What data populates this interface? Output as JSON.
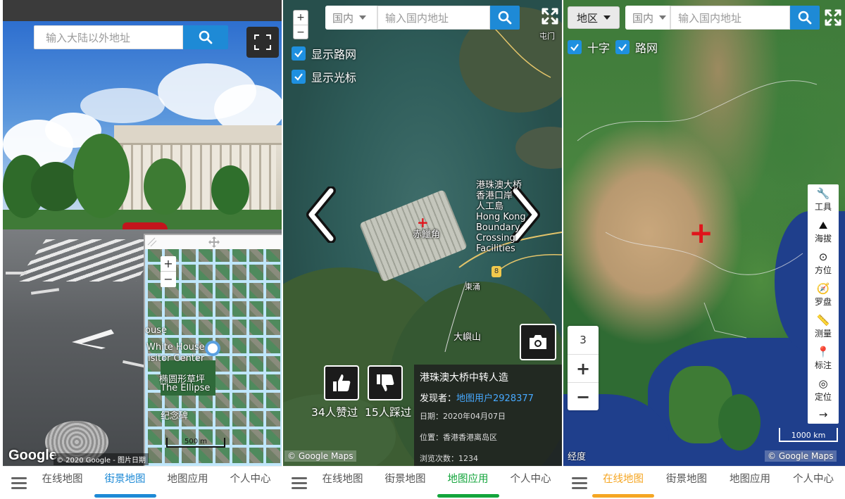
{
  "panel_streetview": {
    "search_placeholder": "输入大陆以外地址",
    "google_logo": "Google",
    "copyright": "© 2020 Google - 图片日期",
    "inset_map": {
      "zoom_in": "+",
      "zoom_out": "−",
      "labels": [
        "ouse",
        "White House",
        "isitor Center",
        "椭圆形草坪",
        "The Ellipse",
        "纪念碑"
      ],
      "scale": "500 m"
    }
  },
  "panel_satellite": {
    "region_select": "国内",
    "search_placeholder": "输入国内地址",
    "zoom_in": "+",
    "zoom_out": "−",
    "show_roads_label": "显示路网",
    "show_cursor_label": "显示光标",
    "map_labels": {
      "bridge": "港珠澳大桥\n香港口岸\n人工島\nHong Kong\nBoundary\nCrossing\nFacilities",
      "airport": "赤鱲角",
      "tung_chung": "東涌",
      "mountain": "大嶼山",
      "town": "屯门",
      "route": "8"
    },
    "votes": {
      "likes_text": "34人赞过",
      "dislikes_text": "15人踩过"
    },
    "info": {
      "title": "港珠澳大桥中转人造",
      "discoverer_label": "发现者：",
      "discoverer": "地图用户2928377",
      "date": "日期：2020年04月07日",
      "location": "位置：香港香港离岛区",
      "views": "浏览次数：1234"
    },
    "attribution": "© Google Maps"
  },
  "panel_china": {
    "region_button": "地区",
    "region_select": "国内",
    "search_placeholder": "输入国内地址",
    "cross_label": "十字",
    "roads_label": "路网",
    "tools": [
      {
        "icon": "wrench-icon",
        "glyph": "🔧",
        "label": "工具"
      },
      {
        "icon": "elevation-icon",
        "glyph": "⛰",
        "label": "海拔"
      },
      {
        "icon": "direction-icon",
        "glyph": "⊙",
        "label": "方位"
      },
      {
        "icon": "compass-icon",
        "glyph": "🧭",
        "label": "罗盘"
      },
      {
        "icon": "ruler-icon",
        "glyph": "📏",
        "label": "测量"
      },
      {
        "icon": "pin-icon",
        "glyph": "📍",
        "label": "标注"
      },
      {
        "icon": "locate-icon",
        "glyph": "◎",
        "label": "定位"
      }
    ],
    "tools_more": "→",
    "zoom_level": "3",
    "zoom_in": "+",
    "zoom_out": "−",
    "scale": "1000 km",
    "coord_label": "经度",
    "attribution": "© Google Maps"
  },
  "bottom_nav": {
    "items": [
      "在线地图",
      "街景地图",
      "地图应用",
      "个人中心"
    ]
  },
  "colors": {
    "accent_blue": "#1e8ad6",
    "active_streetview": "#1e8ad6",
    "active_apps": "#14a53c",
    "active_online": "#f5a623",
    "marker_red": "#e0141b"
  }
}
